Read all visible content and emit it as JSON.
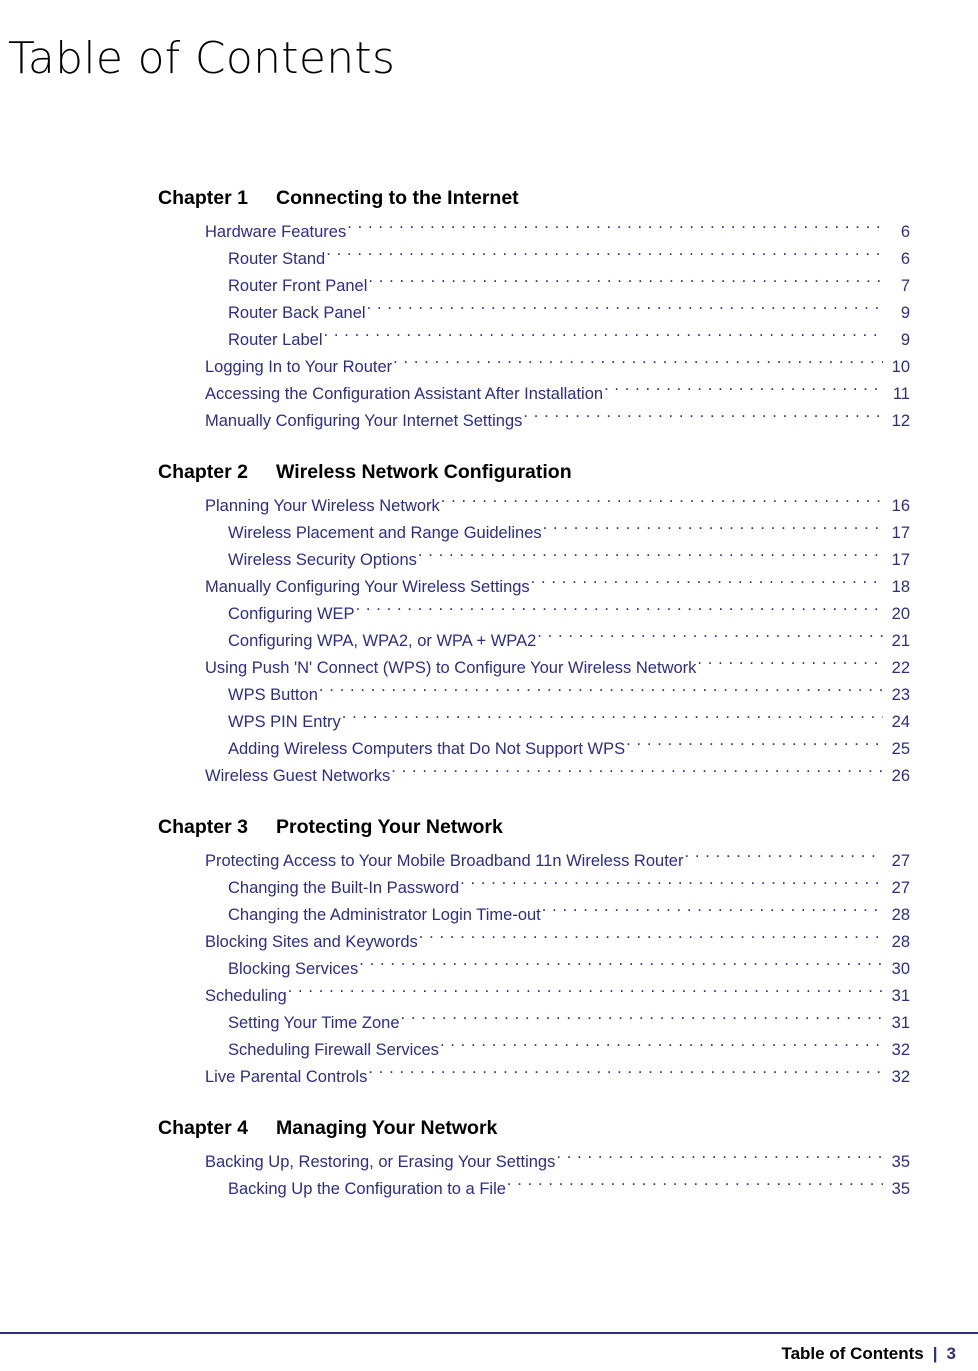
{
  "document": {
    "title": "Table of Contents",
    "accent_color": "#2d2d86",
    "text_color": "#000000"
  },
  "chapters": [
    {
      "number_label": "Chapter 1",
      "title": "Connecting to the Internet",
      "entries": [
        {
          "level": 1,
          "title": "Hardware Features",
          "page": "6"
        },
        {
          "level": 2,
          "title": "Router Stand",
          "page": "6"
        },
        {
          "level": 2,
          "title": "Router Front Panel",
          "page": "7"
        },
        {
          "level": 2,
          "title": "Router Back Panel",
          "page": "9"
        },
        {
          "level": 2,
          "title": "Router Label",
          "page": "9"
        },
        {
          "level": 1,
          "title": "Logging In to Your Router",
          "page": "10"
        },
        {
          "level": 1,
          "title": "Accessing the Configuration Assistant After Installation",
          "page": "11"
        },
        {
          "level": 1,
          "title": "Manually Configuring Your Internet Settings",
          "page": "12"
        }
      ]
    },
    {
      "number_label": "Chapter 2",
      "title": "Wireless Network Configuration",
      "entries": [
        {
          "level": 1,
          "title": "Planning Your Wireless Network",
          "page": "16"
        },
        {
          "level": 2,
          "title": "Wireless Placement and Range Guidelines",
          "page": "17"
        },
        {
          "level": 2,
          "title": "Wireless Security Options",
          "page": "17"
        },
        {
          "level": 1,
          "title": "Manually Configuring Your Wireless Settings",
          "page": "18"
        },
        {
          "level": 2,
          "title": "Configuring WEP",
          "page": "20"
        },
        {
          "level": 2,
          "title": "Configuring WPA, WPA2, or WPA + WPA2",
          "page": "21"
        },
        {
          "level": 1,
          "title": "Using Push 'N' Connect (WPS) to Configure Your Wireless Network",
          "page": "22"
        },
        {
          "level": 2,
          "title": "WPS Button",
          "page": "23"
        },
        {
          "level": 2,
          "title": "WPS PIN Entry",
          "page": "24"
        },
        {
          "level": 2,
          "title": "Adding Wireless Computers that Do Not Support WPS",
          "page": "25"
        },
        {
          "level": 1,
          "title": "Wireless Guest Networks",
          "page": "26"
        }
      ]
    },
    {
      "number_label": "Chapter 3",
      "title": "Protecting Your Network",
      "entries": [
        {
          "level": 1,
          "title": "Protecting Access to Your Mobile Broadband 11n Wireless Router",
          "page": "27"
        },
        {
          "level": 2,
          "title": "Changing the Built-In Password",
          "page": "27"
        },
        {
          "level": 2,
          "title": "Changing the Administrator Login Time-out",
          "page": "28"
        },
        {
          "level": 1,
          "title": "Blocking Sites and Keywords",
          "page": "28"
        },
        {
          "level": 2,
          "title": "Blocking Services",
          "page": "30"
        },
        {
          "level": 1,
          "title": "Scheduling",
          "page": "31"
        },
        {
          "level": 2,
          "title": "Setting Your Time Zone",
          "page": "31"
        },
        {
          "level": 2,
          "title": "Scheduling Firewall Services",
          "page": "32"
        },
        {
          "level": 1,
          "title": "Live Parental Controls",
          "page": "32"
        }
      ]
    },
    {
      "number_label": "Chapter 4",
      "title": "Managing Your Network",
      "entries": [
        {
          "level": 1,
          "title": "Backing Up, Restoring, or Erasing Your Settings",
          "page": "35"
        },
        {
          "level": 2,
          "title": "Backing Up the Configuration to a File",
          "page": "35"
        }
      ]
    }
  ],
  "footer": {
    "label": "Table of Contents",
    "separator": "|",
    "page_number": "3"
  }
}
